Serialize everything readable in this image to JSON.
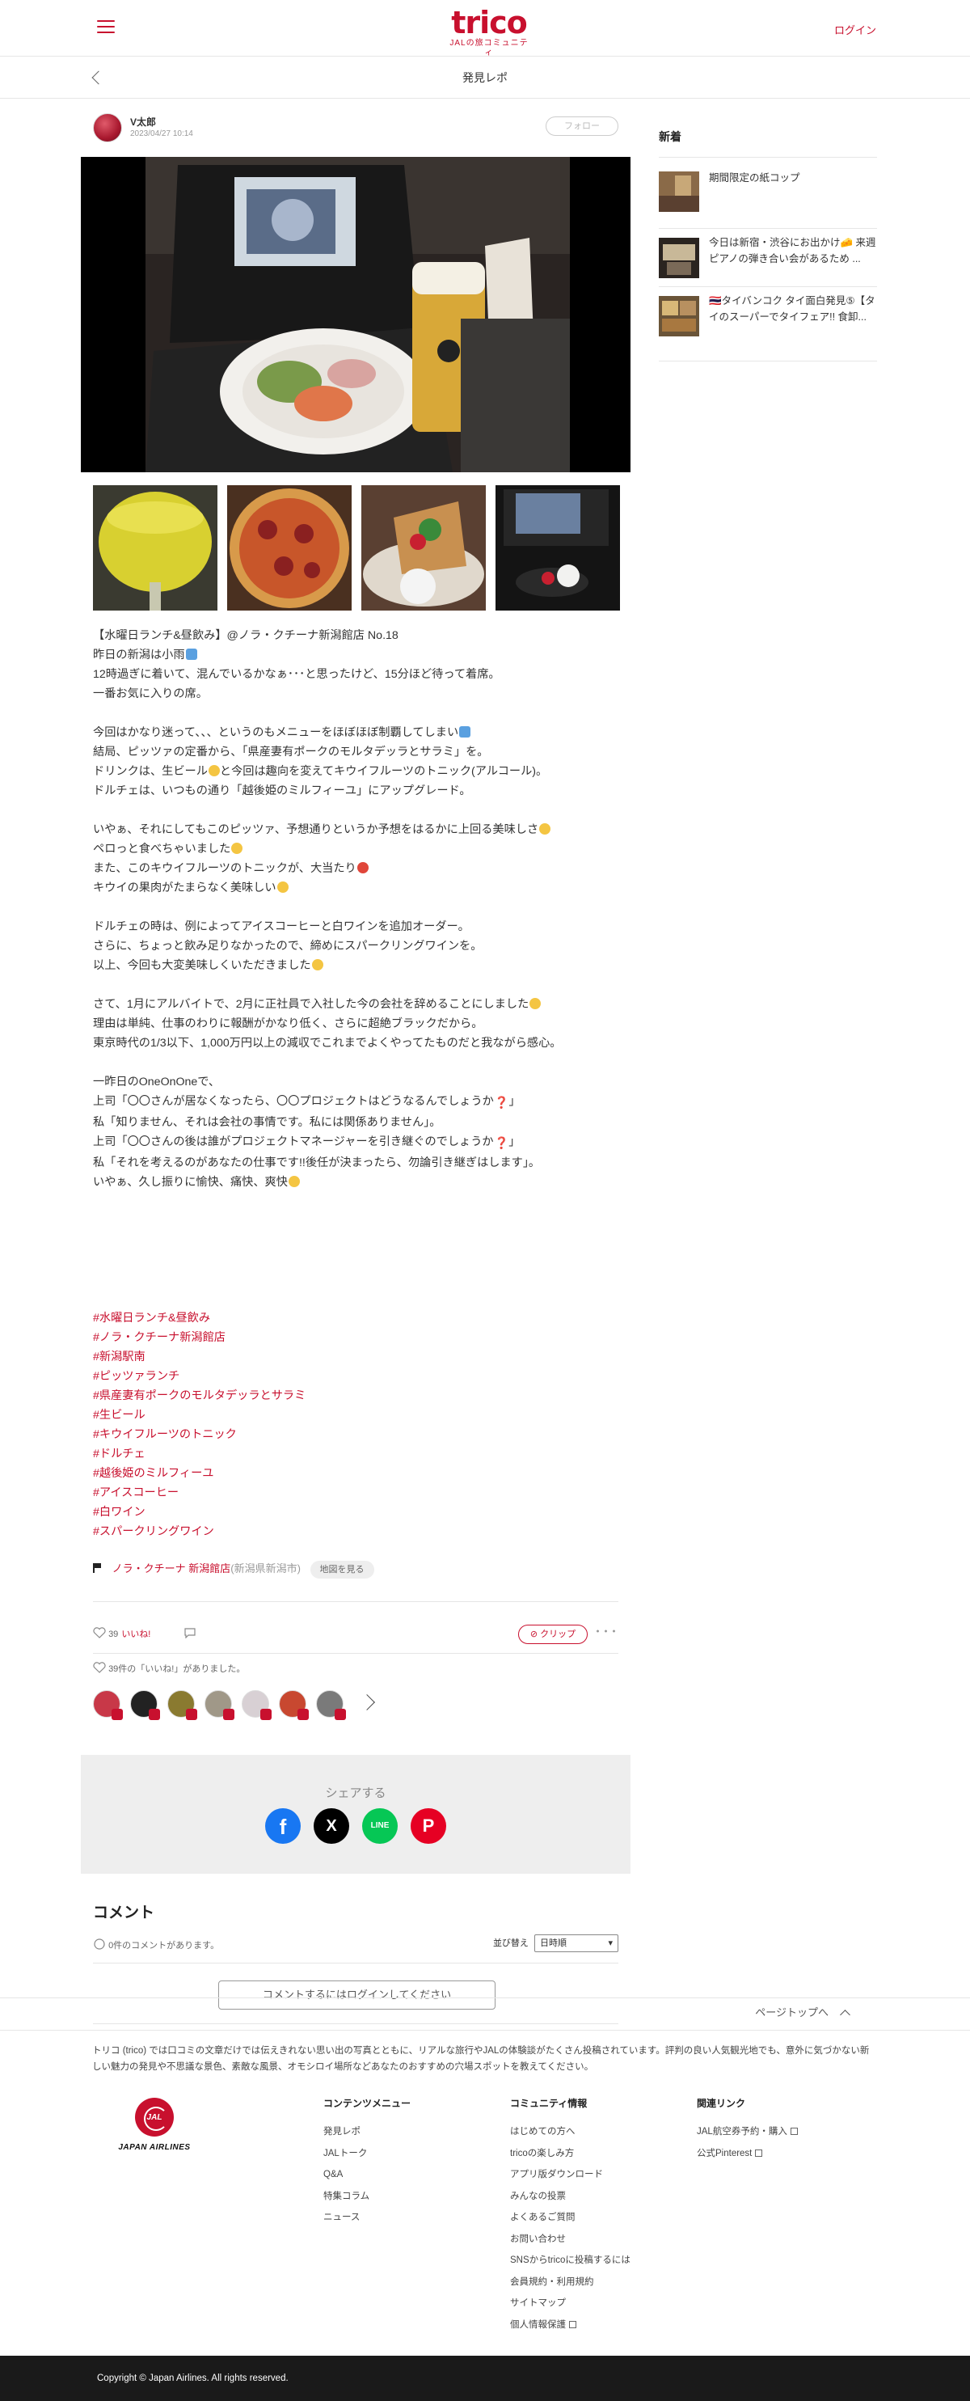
{
  "header": {
    "logo_text": "trico",
    "logo_sub": "JALの旅コミュニティ",
    "login": "ログイン"
  },
  "subheader": {
    "title": "発見レポ"
  },
  "post": {
    "author": "V太郎",
    "date": "2023/04/27 10:14",
    "follow": "フォロー",
    "lines": [
      [
        "【水曜日ランチ&昼飲み】@ノラ・クチーナ新潟館店 No.18"
      ],
      [
        "昨日の新潟は小雨",
        "☂"
      ],
      [
        "12時過ぎに着いて、混んでいるかなぁ･･･と思ったけど、15分ほど待って着席。"
      ],
      [
        "一番お気に入りの席。"
      ],
      [
        ""
      ],
      [
        "今回はかなり迷って、、、というのもメニューをほぼほぼ制覇してしまい",
        "💦"
      ],
      [
        "結局、ピッツァの定番から、「県産妻有ポークのモルタデッラとサラミ」を。"
      ],
      [
        "ドリンクは、生ビール",
        "🍺",
        "と今回は趣向を変えてキウイフルーツのトニック(アルコール)。"
      ],
      [
        "ドルチェは、いつもの通り「越後姫のミルフィーユ」にアップグレード。"
      ],
      [
        ""
      ],
      [
        "いやぁ、それにしてもこのピッツァ、予想通りというか予想をはるかに上回る美味しさ",
        "😋"
      ],
      [
        "ペロっと食べちゃいました",
        "😊"
      ],
      [
        "また、このキウイフルーツのトニックが、大当たり",
        "🎯"
      ],
      [
        "キウイの果肉がたまらなく美味しい",
        "😋"
      ],
      [
        ""
      ],
      [
        "ドルチェの時は、例によってアイスコーヒーと白ワインを追加オーダー。"
      ],
      [
        "さらに、ちょっと飲み足りなかったので、締めにスパークリングワインを。"
      ],
      [
        "以上、今回も大変美味しくいただきました",
        "😋"
      ],
      [
        ""
      ],
      [
        "さて、1月にアルバイトで、2月に正社員で入社した今の会社を辞めることにしました",
        "😊"
      ],
      [
        "理由は単純、仕事のわりに報酬がかなり低く、さらに超絶ブラックだから。"
      ],
      [
        "東京時代の1/3以下、1,000万円以上の減収でこれまでよくやってたものだと我ながら感心。"
      ],
      [
        ""
      ],
      [
        "一昨日のOneOnOneで、"
      ],
      [
        "上司「〇〇さんが居なくなったら、〇〇プロジェクトはどうなるんでしょうか",
        "❓",
        "」"
      ],
      [
        "私「知りません、それは会社の事情です。私には関係ありません」。"
      ],
      [
        "上司「〇〇さんの後は誰がプロジェクトマネージャーを引き継ぐのでしょうか",
        "❓",
        "」"
      ],
      [
        "私「それを考えるのがあなたの仕事です!!後任が決まったら、勿論引き継ぎはします」。"
      ],
      [
        "いやぁ、久し振りに愉快、痛快、爽快",
        "😊"
      ]
    ],
    "tags": [
      "#水曜日ランチ&昼飲み",
      "#ノラ・クチーナ新潟館店",
      "#新潟駅南",
      "#ピッツァランチ",
      "#県産妻有ポークのモルタデッラとサラミ",
      "#生ビール",
      "#キウイフルーツのトニック",
      "#ドルチェ",
      "#越後姫のミルフィーユ",
      "#アイスコーヒー",
      "#白ワイン",
      "#スパークリングワイン"
    ],
    "place_name": "ノラ・クチーナ 新潟館店",
    "place_area": "(新潟県新潟市)",
    "map_button": "地図を見る",
    "like_count": "39",
    "like_label": "いいね!",
    "clip_label": "クリップ",
    "more_label": "･･･",
    "like_info": "39件の「いいね!」がありました。"
  },
  "share": {
    "title": "シェアする",
    "buttons": [
      {
        "name": "facebook",
        "glyph": "f",
        "color": "#1877f2"
      },
      {
        "name": "x",
        "glyph": "X",
        "color": "#000000"
      },
      {
        "name": "line",
        "glyph": "LINE",
        "color": "#06c755"
      },
      {
        "name": "pinterest",
        "glyph": "P",
        "color": "#e60023"
      }
    ]
  },
  "comments": {
    "title": "コメント",
    "count": "0件のコメントがあります。",
    "sort_label": "並び替え",
    "sort_value": "日時順",
    "login_button": "コメントするにはログインしてください"
  },
  "sidebar": {
    "title": "新着",
    "items": [
      {
        "text": "期間限定の紙コップ"
      },
      {
        "text": "今日は新宿・渋谷にお出かけ🧀 来週ピアノの弾き合い会があるため ..."
      },
      {
        "text": "🇹🇭タイバンコク タイ面白発見⑤【タイのスーパーでタイフェア!! 食卸..."
      }
    ]
  },
  "footer": {
    "page_top": "ページトップへ",
    "description": "トリコ (trico) では口コミの文章だけでは伝えきれない思い出の写真とともに、リアルな旅行やJALの体験談がたくさん投稿されています。評判の良い人気観光地でも、意外に気づかない新しい魅力の発見や不思議な景色、素敵な風景、オモシロイ場所などあなたのおすすめの穴場スポットを教えてください。",
    "brand": "JAL",
    "brand_name": "JAPAN AIRLINES",
    "contents_title": "コンテンツメニュー",
    "contents": [
      "発見レポ",
      "JALトーク",
      "Q&A",
      "特集コラム",
      "ニュース"
    ],
    "community_title": "コミュニティ情報",
    "community": [
      "はじめての方へ",
      "tricoの楽しみ方",
      "アプリ版ダウンロード",
      "みんなの投票",
      "よくあるご質問",
      "お問い合わせ",
      "SNSからtricoに投稿するには",
      "会員規約・利用規約",
      "サイトマップ",
      "個人情報保護"
    ],
    "links_title": "関連リンク",
    "links": [
      "JAL航空券予約・購入",
      "公式Pinterest"
    ],
    "copyright": "Copyright © Japan Airlines. All rights reserved."
  },
  "colors": {
    "brand": "#c8102e",
    "share_bg": "#eeeeee",
    "footer_bar": "#1a1a1a"
  }
}
